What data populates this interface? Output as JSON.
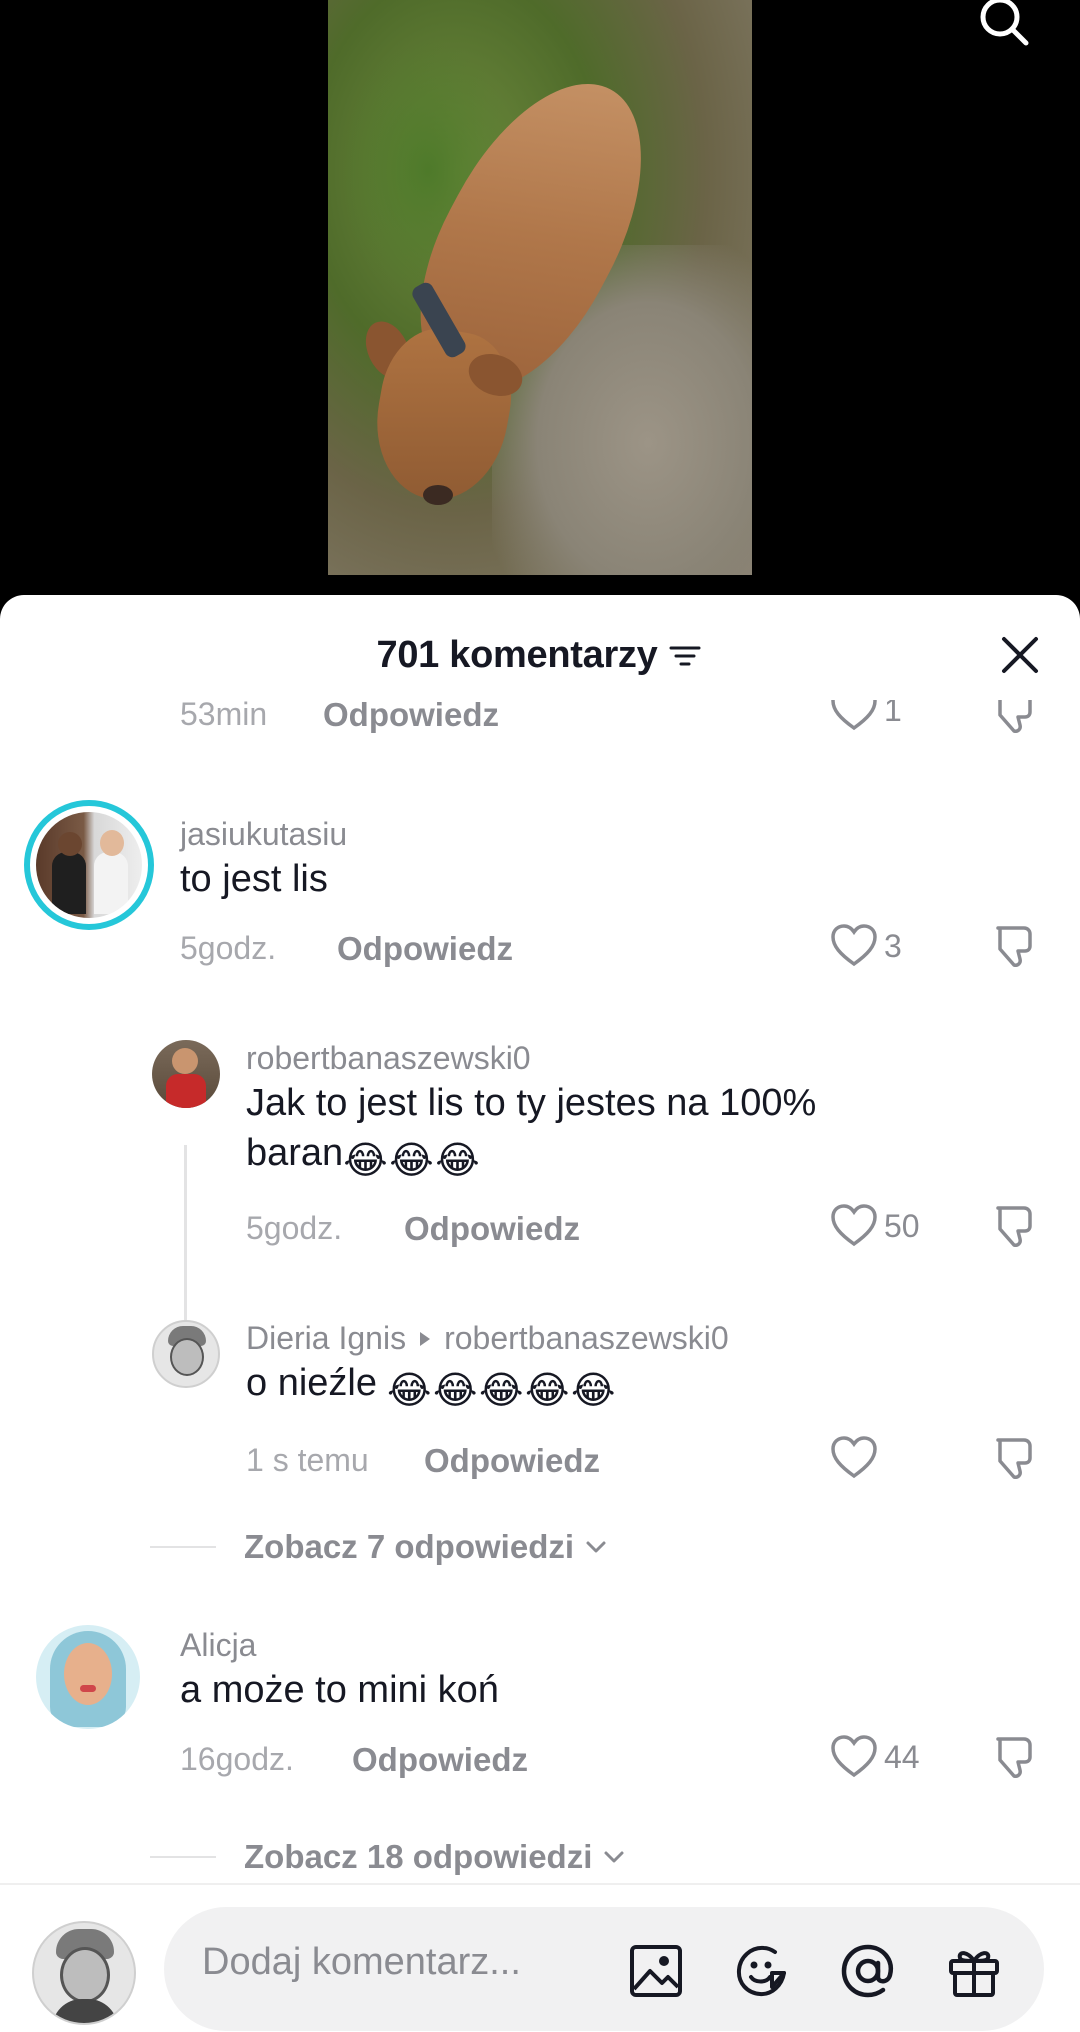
{
  "sheet": {
    "title": "701 komentarzy"
  },
  "cut_comment": {
    "time": "53min",
    "reply_label": "Odpowiedz",
    "likes": "1"
  },
  "comments": [
    {
      "username": "jasiukutasiu",
      "text": "to jest lis",
      "time": "5godz.",
      "reply_label": "Odpowiedz",
      "likes": "3"
    },
    {
      "username": "robertbanaszewski0",
      "text_line1": "Jak to jest lis to ty jestes na 100%",
      "text_line2": "baran",
      "emoji": "😂",
      "time": "5godz.",
      "reply_label": "Odpowiedz",
      "likes": "50"
    },
    {
      "username": "Dieria Ignis",
      "reply_to": "robertbanaszewski0",
      "text": "o nieźle",
      "emoji": "😂",
      "time": "1 s temu",
      "reply_label": "Odpowiedz",
      "likes": ""
    },
    {
      "username": "Alicja",
      "text": "a może to mini koń",
      "time": "16godz.",
      "reply_label": "Odpowiedz",
      "likes": "44"
    }
  ],
  "view_more": [
    {
      "label": "Zobacz 7 odpowiedzi"
    },
    {
      "label": "Zobacz 18 odpowiedzi"
    }
  ],
  "input": {
    "placeholder": "Dodaj komentarz..."
  },
  "icons": {
    "search": "search-icon",
    "filter": "filter-icon",
    "close": "close-icon",
    "like": "heart-icon",
    "dislike": "thumbs-down-icon",
    "image": "image-icon",
    "emoji": "emoji-icon",
    "mention": "at-icon",
    "gift": "gift-icon"
  },
  "colors": {
    "story_ring": "#25c7d9",
    "text_primary": "#161823",
    "text_secondary": "#8a8b91"
  }
}
